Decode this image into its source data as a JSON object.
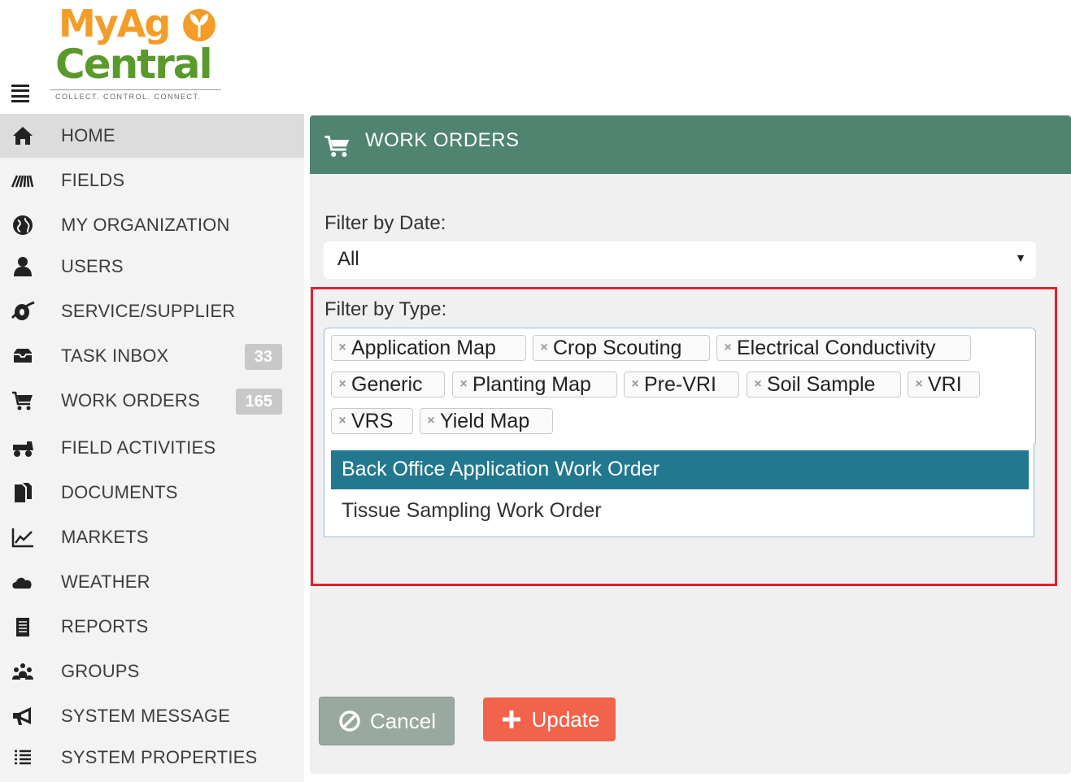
{
  "logo": {
    "line1": "MyAg",
    "line2": "Central",
    "tagline": "COLLECT. CONTROL. CONNECT."
  },
  "sidebar": {
    "items": [
      {
        "label": "HOME",
        "icon": "home-icon",
        "active": true
      },
      {
        "label": "FIELDS",
        "icon": "fields-icon"
      },
      {
        "label": "MY ORGANIZATION",
        "icon": "globe-icon"
      },
      {
        "label": "USERS",
        "icon": "user-icon"
      },
      {
        "label": "SERVICE/SUPPLIER",
        "icon": "service-icon"
      },
      {
        "label": "TASK INBOX",
        "icon": "inbox-icon",
        "badge": "33"
      },
      {
        "label": "WORK ORDERS",
        "icon": "cart-icon",
        "badge": "165"
      },
      {
        "label": "FIELD ACTIVITIES",
        "icon": "tractor-icon"
      },
      {
        "label": "DOCUMENTS",
        "icon": "documents-icon"
      },
      {
        "label": "MARKETS",
        "icon": "chart-line-icon"
      },
      {
        "label": "WEATHER",
        "icon": "cloud-icon"
      },
      {
        "label": "REPORTS",
        "icon": "report-icon"
      },
      {
        "label": "GROUPS",
        "icon": "group-icon"
      },
      {
        "label": "SYSTEM MESSAGE",
        "icon": "megaphone-icon"
      },
      {
        "label": "SYSTEM PROPERTIES",
        "icon": "list-icon"
      }
    ]
  },
  "panel": {
    "title": "WORK ORDERS",
    "filter_date": {
      "label": "Filter by Date:",
      "value": "All"
    },
    "filter_type": {
      "label": "Filter by Type:",
      "tags": [
        "Application Map",
        "Crop Scouting",
        "Electrical Conductivity",
        "Generic",
        "Planting Map",
        "Pre-VRI",
        "Soil Sample",
        "VRI",
        "VRS",
        "Yield Map"
      ],
      "tag_remove_glyph": "×",
      "options": [
        "Back Office Application Work Order",
        "Tissue Sampling Work Order"
      ],
      "highlighted_option": 0
    },
    "buttons": {
      "cancel": "Cancel",
      "update": "Update"
    }
  },
  "colors": {
    "header": "#4f8470",
    "highlight_border": "#e2202c",
    "selected_option": "#22788f",
    "update_button": "#f2634b",
    "cancel_button": "#9aa99f",
    "logo_orange": "#f39c27",
    "logo_green": "#5a9a2c"
  }
}
